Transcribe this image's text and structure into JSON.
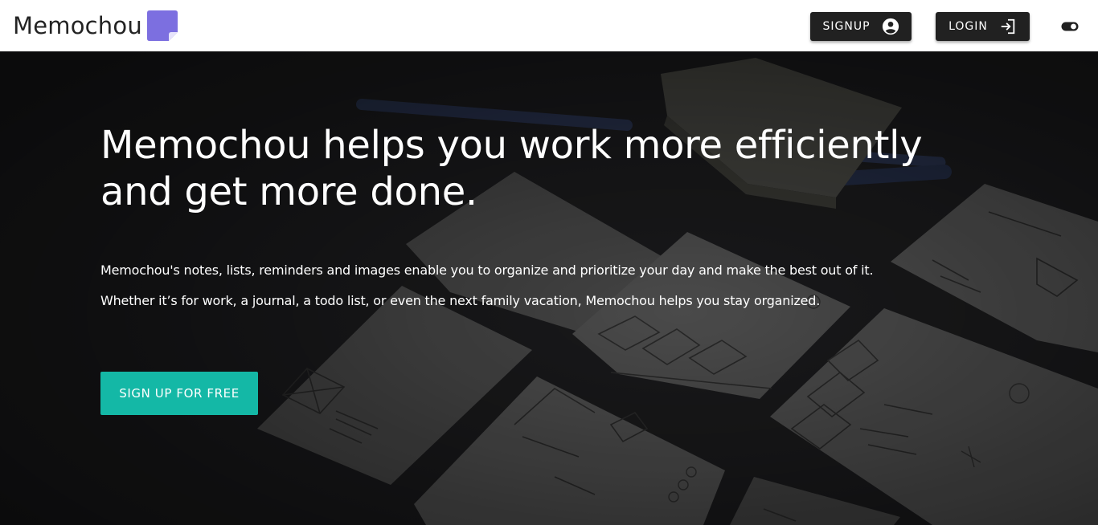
{
  "header": {
    "brand_name": "Memochou",
    "signup_label": "SIGNUP",
    "login_label": "LOGIN"
  },
  "hero": {
    "title_line1": "Memochou helps you work more efficiently",
    "title_line2": "and get more done.",
    "paragraph1": "Memochou's notes, lists, reminders and images enable you to organize and prioritize your day and make the best out of it.",
    "paragraph2": "Whether it’s for work, a journal, a todo list, or even the next family vacation, Memochou helps you stay organized.",
    "cta_label": "SIGN UP FOR FREE"
  },
  "icons": {
    "brand_logo": "sticky-note-icon",
    "signup": "account-circle-icon",
    "login": "login-arrow-icon",
    "theme": "theme-toggle-icon"
  },
  "colors": {
    "brand_purple": "#7c6fe0",
    "button_dark": "#212121",
    "cta_teal": "#14b8a6",
    "header_bg": "#ffffff"
  }
}
